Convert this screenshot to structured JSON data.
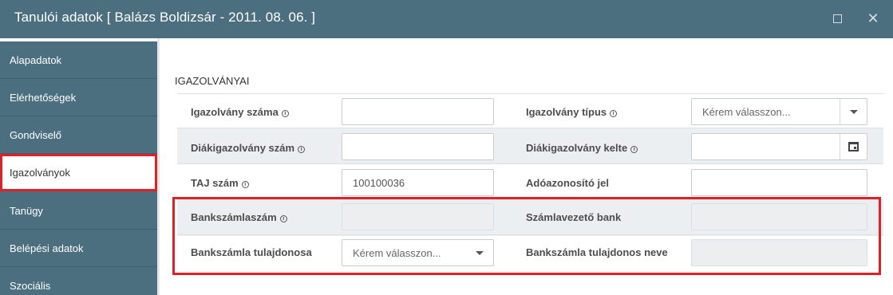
{
  "window": {
    "title": "Tanulói adatok [ Balázs Boldizsár - 2011. 08. 06. ]",
    "maximize_icon": "maximize-icon",
    "close_icon": "close-icon",
    "close_glyph": "✕"
  },
  "sidebar": {
    "items": [
      {
        "label": "Alapadatok"
      },
      {
        "label": "Elérhetőségek"
      },
      {
        "label": "Gondviselő"
      },
      {
        "label": "Igazolványok",
        "active": true
      },
      {
        "label": "Tanügy"
      },
      {
        "label": "Belépési adatok"
      },
      {
        "label": "Szociális"
      }
    ]
  },
  "section": {
    "title": "IGAZOLVÁNYAI"
  },
  "form": {
    "id_number": {
      "label": "Igazolvány száma",
      "value": ""
    },
    "id_type": {
      "label": "Igazolvány típus",
      "value": "Kérem válasszon..."
    },
    "student_id_number": {
      "label": "Diákigazolvány szám",
      "value": ""
    },
    "student_id_date": {
      "label": "Diákigazolvány kelte",
      "value": ""
    },
    "taj_number": {
      "label": "TAJ szám",
      "value": "100100036"
    },
    "tax_id": {
      "label": "Adóazonosító jel",
      "value": ""
    },
    "bank_account": {
      "label": "Bankszámlaszám",
      "value": ""
    },
    "bank_name": {
      "label": "Számlavezető bank",
      "value": ""
    },
    "account_owner": {
      "label": "Bankszámla tulajdonosa",
      "value": "Kérem válasszon..."
    },
    "account_owner_name": {
      "label": "Bankszámla tulajdonos neve",
      "value": ""
    }
  },
  "colors": {
    "sidebar_bg": "#4b6f7f",
    "highlight": "#e02027",
    "row_shade": "#eceff1"
  },
  "icons": {
    "info": "info-icon",
    "info_glyph": "i",
    "dropdown": "chevron-down-icon",
    "calendar": "calendar-icon"
  }
}
